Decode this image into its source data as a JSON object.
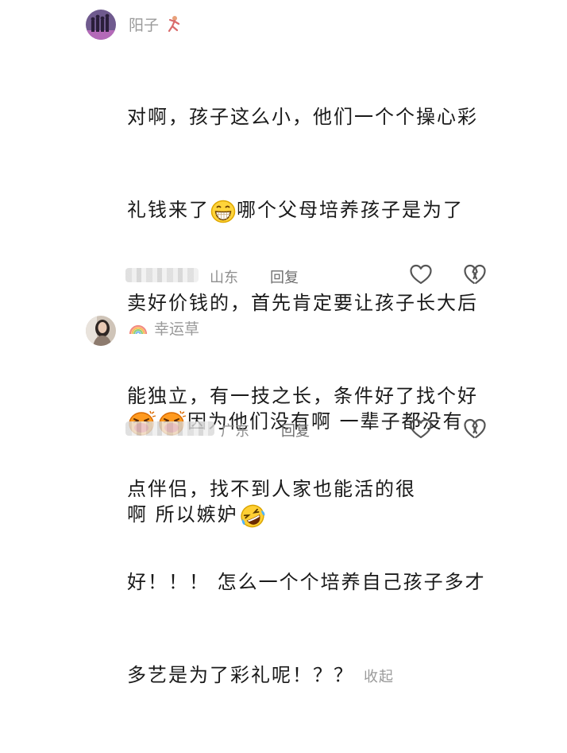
{
  "comments": [
    {
      "username": "阳子",
      "tag_icon": "dancer-icon",
      "lines": [
        [
          "对啊，孩子这么小，他们一个个操心彩"
        ],
        [
          "礼钱来了",
          "grin-emoji",
          "哪个父母培养孩子是为了"
        ],
        [
          "卖好价钱的，首先肯定要让孩子长大后"
        ],
        [
          "能独立，有一技之长，条件好了找个好"
        ],
        [
          "点伴侣，找不到人家也能活的很"
        ],
        [
          "好！！！ 怎么一个个培养自己孩子多才"
        ],
        [
          "多艺是为了彩礼呢！？？"
        ]
      ],
      "collapse_label": "收起",
      "location": "山东",
      "reply_label": "回复"
    },
    {
      "username": "幸运草",
      "tag_icon": "rainbow-icon",
      "lines": [
        [
          "",
          "laugh-emoji",
          "laugh-emoji",
          "因为他们没有啊 一辈子都没有"
        ],
        [
          "啊 所以嫉妒",
          "rofl-emoji"
        ]
      ],
      "location": "广东",
      "reply_label": "回复"
    }
  ],
  "colors": {
    "text": "#1a1a1a",
    "muted": "#9a9a9a",
    "icon": "#555555"
  }
}
